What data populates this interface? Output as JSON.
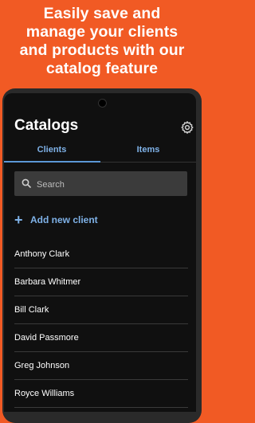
{
  "promo": {
    "line1": "Easily save and",
    "line2": "manage your clients",
    "line3": "and products with our",
    "line4": "catalog feature"
  },
  "header": {
    "title": "Catalogs",
    "settings_icon": "gear-icon"
  },
  "tabs": [
    {
      "label": "Clients",
      "active": true
    },
    {
      "label": "Items",
      "active": false
    }
  ],
  "search": {
    "placeholder": "Search",
    "icon": "search-icon"
  },
  "add_client": {
    "label": "Add new client",
    "icon": "plus-icon"
  },
  "clients": [
    "Anthony Clark",
    "Barbara Whitmer",
    "Bill Clark",
    "David Passmore",
    "Greg Johnson",
    "Royce Williams"
  ],
  "colors": {
    "background": "#F15A24",
    "screen": "#101010",
    "accent": "#7fb2e8",
    "search_field": "#3b3b3b"
  }
}
